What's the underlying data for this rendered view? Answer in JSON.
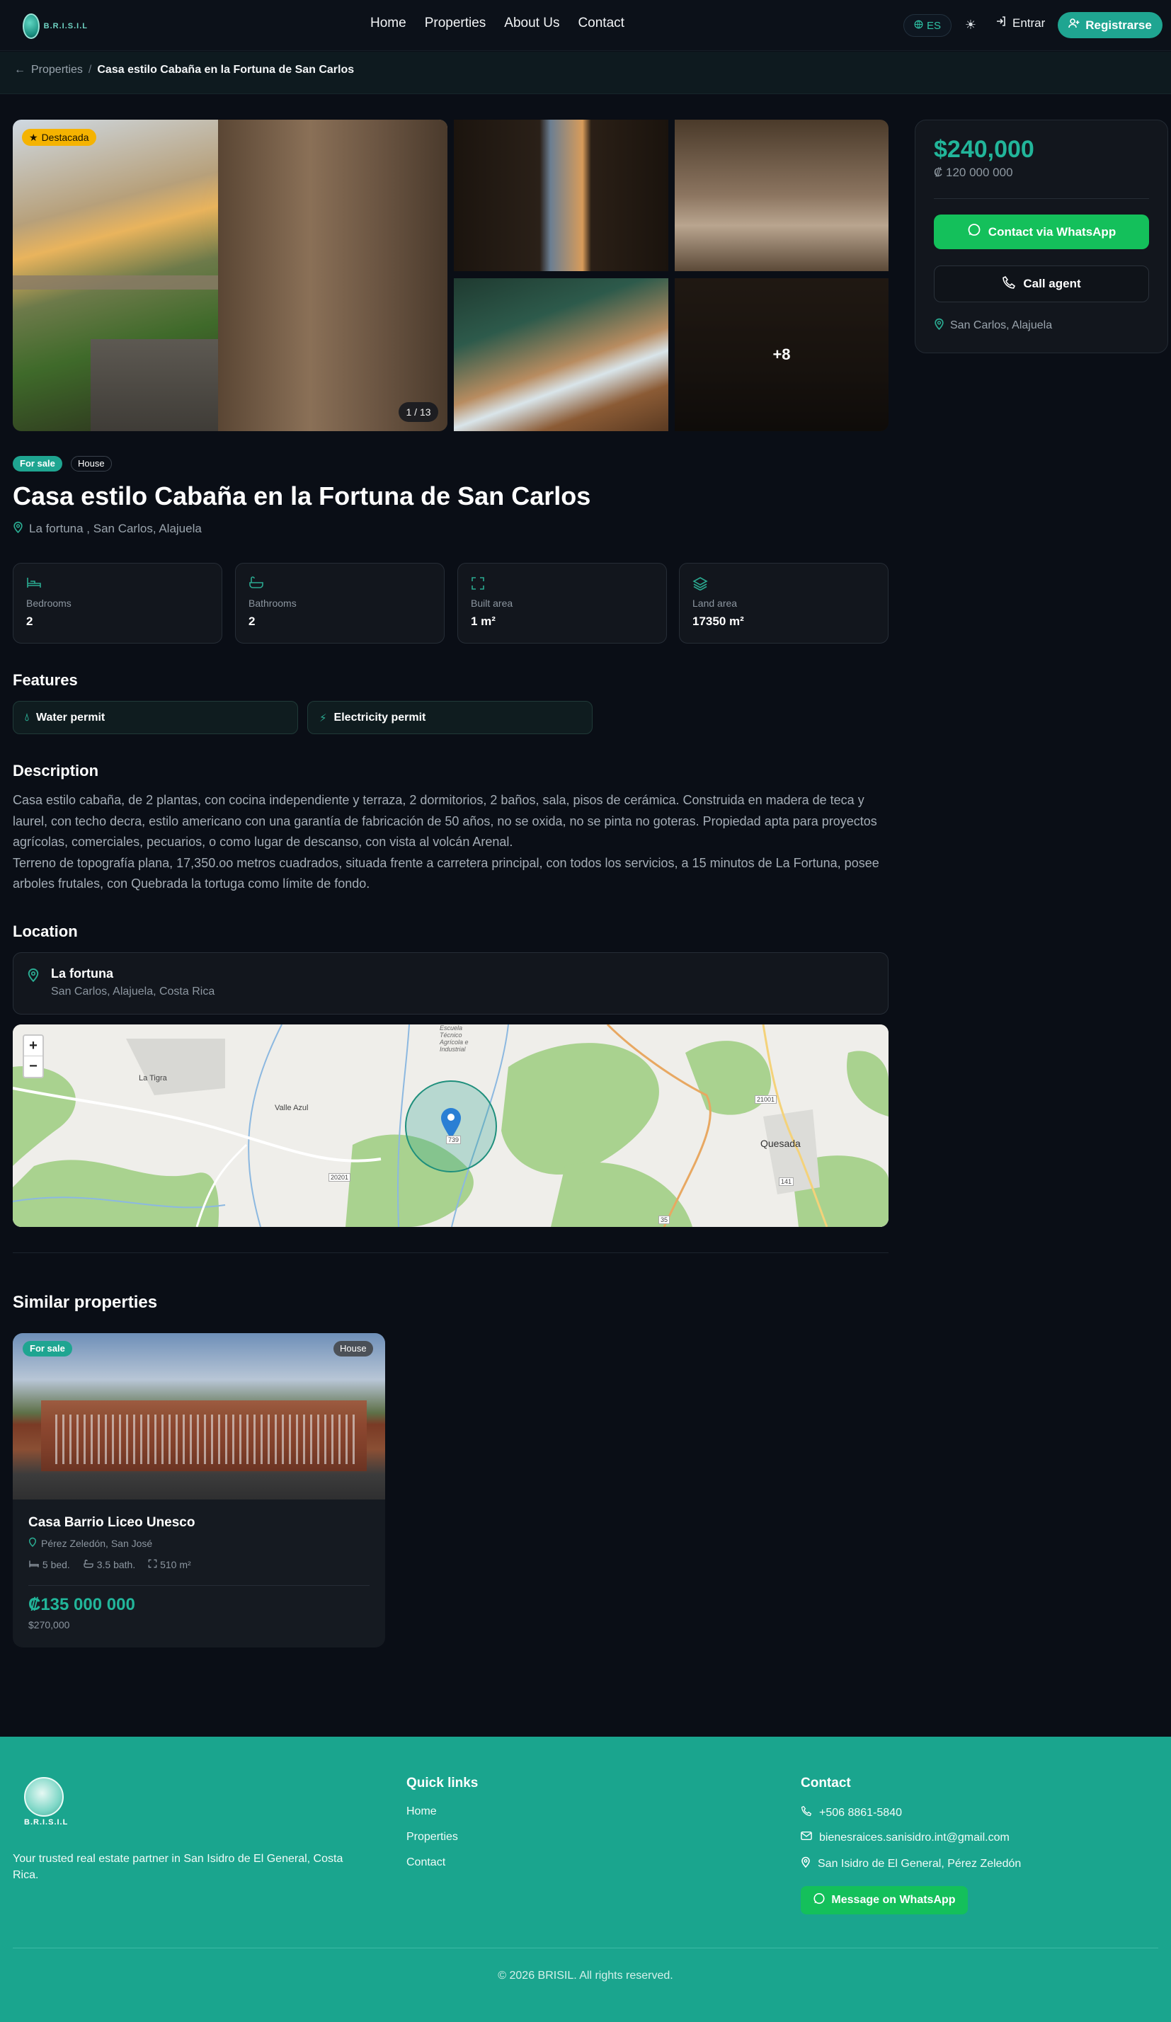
{
  "nav": {
    "logo_text": "B.R.I.S.I.L",
    "links": [
      "Home",
      "Properties",
      "About Us",
      "Contact"
    ],
    "lang": "ES",
    "login": "Entrar",
    "register": "Registrarse"
  },
  "breadcrumb": {
    "parent": "Properties",
    "separator": "/",
    "current": "Casa estilo Cabaña en la Fortuna de San Carlos"
  },
  "gallery": {
    "featured_badge": "Destacada",
    "counter": "1 / 13",
    "more_count": "+8"
  },
  "price_card": {
    "price_usd": "$240,000",
    "price_crc": "₡ 120 000 000",
    "whatsapp_label": "Contact via WhatsApp",
    "call_label": "Call agent",
    "location": "San Carlos, Alajuela"
  },
  "property": {
    "status": "For sale",
    "type": "House",
    "title": "Casa estilo Cabaña en la Fortuna de San Carlos",
    "address": "La fortuna , San Carlos, Alajuela"
  },
  "stats": [
    {
      "label": "Bedrooms",
      "value": "2",
      "icon": "bed-icon"
    },
    {
      "label": "Bathrooms",
      "value": "2",
      "icon": "bath-icon"
    },
    {
      "label": "Built area",
      "value": "1 m²",
      "icon": "expand-icon"
    },
    {
      "label": "Land area",
      "value": "17350 m²",
      "icon": "layers-icon"
    }
  ],
  "features": {
    "heading": "Features",
    "items": [
      "Water permit",
      "Electricity permit"
    ]
  },
  "description": {
    "heading": "Description",
    "paragraph1": "Casa estilo cabaña, de 2 plantas, con cocina independiente y terraza, 2 dormitorios, 2 baños, sala, pisos de cerámica. Construida en madera de teca y laurel, con techo decra, estilo americano con una garantía de fabricación de 50 años, no se oxida, no se pinta no goteras. Propiedad apta para proyectos agrícolas, comerciales, pecuarios, o como lugar de descanso, con vista al volcán Arenal.",
    "paragraph2": "Terreno de topografía plana, 17,350.oo metros cuadrados, situada frente a carretera principal, con todos los servicios, a 15 minutos de La Fortuna, posee arboles frutales, con Quebrada la tortuga como límite de fondo."
  },
  "location": {
    "heading": "Location",
    "name": "La fortuna",
    "sub": "San Carlos, Alajuela, Costa Rica",
    "map_labels": [
      "La Tigra",
      "Valle Azul",
      "Quesada",
      "Escuela Técnico Agrícola e Industrial",
      "739",
      "20201",
      "21001",
      "141",
      "35"
    ],
    "zoom_in": "+",
    "zoom_out": "−"
  },
  "similar": {
    "heading": "Similar properties",
    "card": {
      "status": "For sale",
      "type": "House",
      "title": "Casa Barrio Liceo Unesco",
      "location": "Pérez Zeledón, San José",
      "beds": "5 bed.",
      "baths": "3.5 bath.",
      "area": "510 m²",
      "price_crc": "₡135 000 000",
      "price_usd": "$270,000"
    }
  },
  "footer": {
    "logo_text": "B.R.I.S.I.L",
    "tagline": "Your trusted real estate partner in San Isidro de El General, Costa Rica.",
    "quick_heading": "Quick links",
    "quick_links": [
      "Home",
      "Properties",
      "Contact"
    ],
    "contact_heading": "Contact",
    "phone": "+506 8861-5840",
    "email": "bienesraices.sanisidro.int@gmail.com",
    "address": "San Isidro de El General, Pérez Zeledón",
    "whatsapp_label": "Message on WhatsApp",
    "copyright": "© 2026 BRISIL. All rights reserved."
  },
  "colors": {
    "accent": "#1fa591",
    "whatsapp": "#14c05b",
    "featured": "#f5b301",
    "background": "#0a0e16"
  }
}
